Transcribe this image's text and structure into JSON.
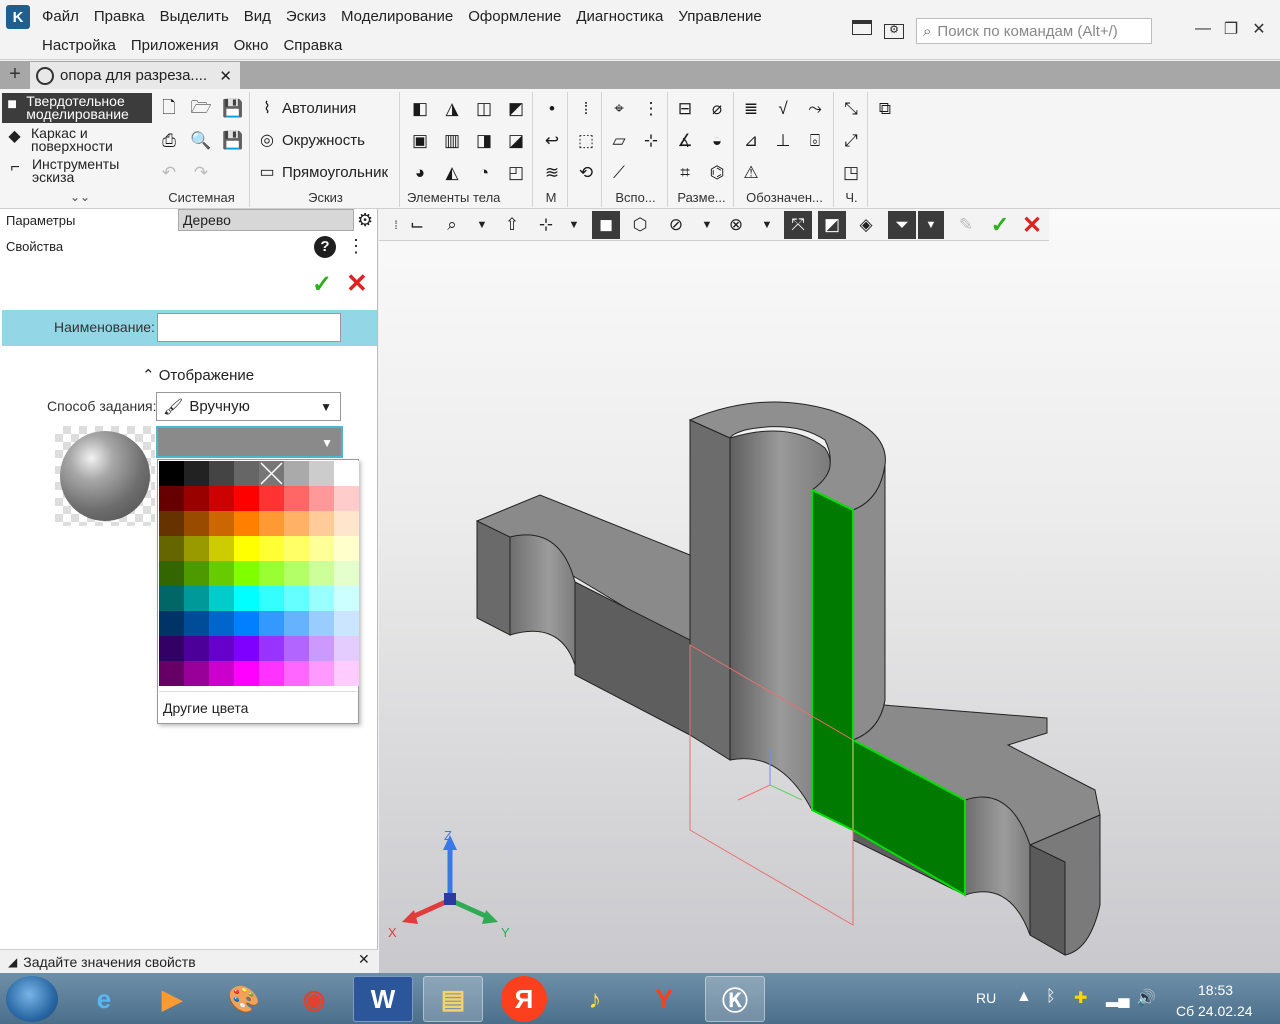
{
  "menu": {
    "row1": [
      "Файл",
      "Правка",
      "Выделить",
      "Вид",
      "Эскиз",
      "Моделирование",
      "Оформление",
      "Диагностика",
      "Управление"
    ],
    "row2": [
      "Настройка",
      "Приложения",
      "Окно",
      "Справка"
    ],
    "search_placeholder": "Поиск по командам (Alt+/)"
  },
  "tabs": {
    "document_title": "опора для разреза....",
    "close": "✕",
    "add": "+"
  },
  "ribbon": {
    "modes": [
      {
        "label": "Твердотельное моделирование",
        "active": true
      },
      {
        "label": "Каркас и поверхности",
        "active": false
      },
      {
        "label": "Инструменты эскиза",
        "active": false
      }
    ],
    "groups": {
      "system": "Системная",
      "sketch": "Эскиз",
      "body": "Элементы тела",
      "m": "М",
      "aux": "Вспо...",
      "dims": "Разме...",
      "marks": "Обозначен...",
      "ch": "Ч."
    },
    "sketch_buttons": [
      "Автолиния",
      "Окружность",
      "Прямоугольник"
    ]
  },
  "left_panel": {
    "params_tab": "Параметры",
    "tree_tab": "Дерево",
    "properties": "Свойства",
    "name_label": "Наименование:",
    "name_value": "",
    "display_header": "Отображение",
    "method_label": "Способ задания:",
    "method_value": "Вручную",
    "palette": {
      "colors": [
        "#000000",
        "#222222",
        "#444444",
        "#666666",
        "none",
        "#aaaaaa",
        "#cccccc",
        "#ffffff",
        "#660000",
        "#990000",
        "#cc0000",
        "#ff0000",
        "#ff3333",
        "#ff6666",
        "#ff9999",
        "#ffcccc",
        "#663300",
        "#994c00",
        "#cc6600",
        "#ff8000",
        "#ff9933",
        "#ffb266",
        "#ffcc99",
        "#ffe5cc",
        "#666600",
        "#999900",
        "#cccc00",
        "#ffff00",
        "#ffff33",
        "#ffff66",
        "#ffff99",
        "#ffffcc",
        "#336600",
        "#4c9900",
        "#66cc00",
        "#80ff00",
        "#99ff33",
        "#b2ff66",
        "#ccff99",
        "#e5ffcc",
        "#006666",
        "#009999",
        "#00cccc",
        "#00ffff",
        "#33ffff",
        "#66ffff",
        "#99ffff",
        "#ccffff",
        "#003366",
        "#004c99",
        "#0066cc",
        "#0080ff",
        "#3399ff",
        "#66b2ff",
        "#99ccff",
        "#cce5ff",
        "#330066",
        "#4c0099",
        "#6600cc",
        "#8000ff",
        "#9933ff",
        "#b266ff",
        "#cc99ff",
        "#e5ccff",
        "#660066",
        "#990099",
        "#cc00cc",
        "#ff00ff",
        "#ff33ff",
        "#ff66ff",
        "#ff99ff",
        "#ffccff"
      ],
      "other_colors": "Другие цвета"
    },
    "status": "Задайте значения свойств"
  },
  "viewport": {
    "axes": {
      "x": "X",
      "y": "Y",
      "z": "Z"
    }
  },
  "taskbar": {
    "items": [
      "ie",
      "media",
      "paint",
      "chrome",
      "word",
      "explorer",
      "Я",
      "yandex-music",
      "yandex-browser",
      "kompas"
    ],
    "lang": "RU",
    "time": "18:53",
    "date": "Сб 24.02.24"
  }
}
